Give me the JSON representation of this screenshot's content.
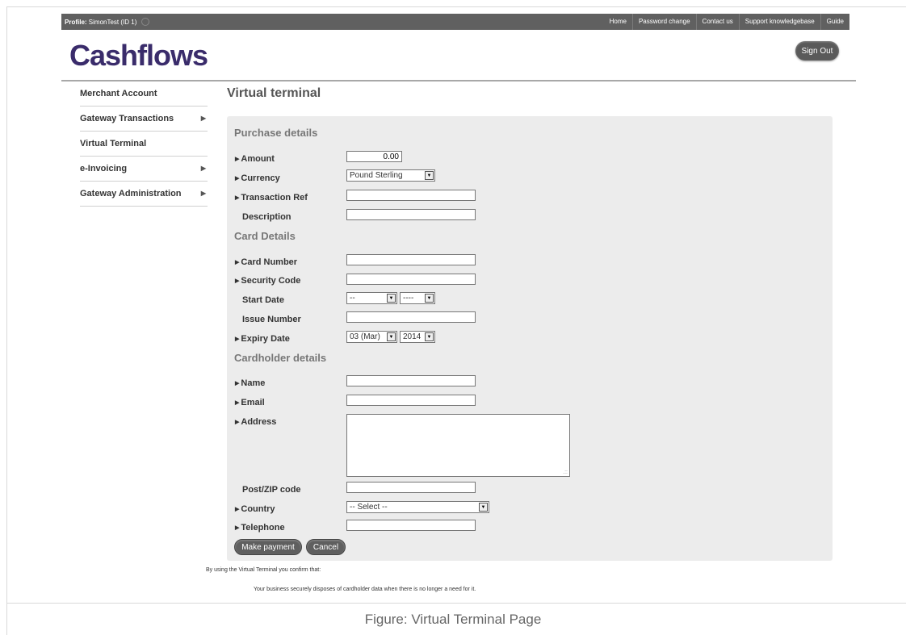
{
  "topbar": {
    "profile_label": "Profile:",
    "profile_value": "SimonTest (ID 1)",
    "nav": [
      "Home",
      "Password change",
      "Contact us",
      "Support knowledgebase",
      "Guide"
    ]
  },
  "brand": {
    "logo": "Cashflows",
    "color": "#3a2c6b"
  },
  "header": {
    "signout": "Sign Out"
  },
  "sidebar": {
    "items": [
      {
        "label": "Merchant Account",
        "has_arrow": false
      },
      {
        "label": "Gateway Transactions",
        "has_arrow": true
      },
      {
        "label": "Virtual Terminal",
        "has_arrow": false
      },
      {
        "label": "e-Invoicing",
        "has_arrow": true
      },
      {
        "label": "Gateway Administration",
        "has_arrow": true
      }
    ]
  },
  "page": {
    "title": "Virtual terminal"
  },
  "purchase": {
    "title": "Purchase details",
    "amount_label": "Amount",
    "amount_value": "0.00",
    "currency_label": "Currency",
    "currency_value": "Pound Sterling",
    "txref_label": "Transaction Ref",
    "description_label": "Description"
  },
  "card": {
    "title": "Card Details",
    "number_label": "Card Number",
    "security_label": "Security Code",
    "start_label": "Start Date",
    "start_month": "--",
    "start_year": "----",
    "issue_label": "Issue Number",
    "expiry_label": "Expiry Date",
    "expiry_month": "03 (Mar)",
    "expiry_year": "2014"
  },
  "holder": {
    "title": "Cardholder details",
    "name_label": "Name",
    "email_label": "Email",
    "address_label": "Address",
    "postcode_label": "Post/ZIP code",
    "country_label": "Country",
    "country_value": "-- Select --",
    "telephone_label": "Telephone"
  },
  "actions": {
    "make_payment": "Make payment",
    "cancel": "Cancel"
  },
  "notice": {
    "line1": "By using the Virtual Terminal you confirm that:",
    "line2": "Your business securely disposes of cardholder data when there is no longer a need for it."
  },
  "caption": "Figure: Virtual Terminal Page",
  "icons": {
    "menu_arrow": "triangle-right-icon",
    "dropdown": "chevron-down-icon",
    "required": "triangle-right-icon"
  }
}
